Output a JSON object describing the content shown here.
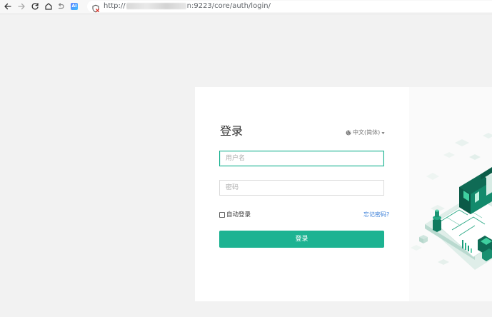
{
  "browser": {
    "url_prefix": "http://",
    "url_suffix": "n:9223/core/auth/login/",
    "ai_badge": "AI",
    "icons": [
      "back-arrow-icon",
      "forward-arrow-icon",
      "reload-icon",
      "home-icon",
      "undo-icon",
      "ai-assistant-icon",
      "not-secure-icon"
    ]
  },
  "login": {
    "title": "登录",
    "language": "中文(简体)",
    "username_placeholder": "用户名",
    "password_placeholder": "密码",
    "remember_label": "自动登录",
    "forgot_label": "忘记密码?",
    "submit_label": "登录"
  },
  "colors": {
    "accent": "#1db392",
    "link": "#3b7fd8",
    "background": "#f2f2f2",
    "card": "#ffffff"
  }
}
